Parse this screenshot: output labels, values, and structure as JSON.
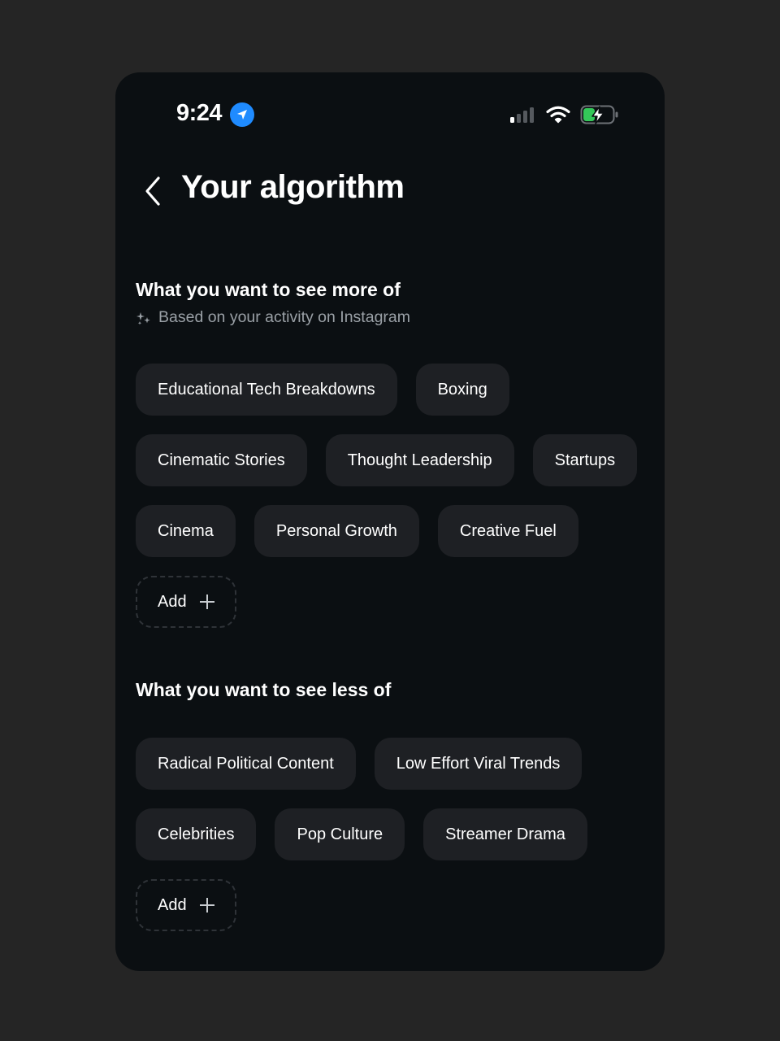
{
  "status_bar": {
    "time": "9:24",
    "icons": [
      "location-arrow-icon",
      "signal-icon",
      "wifi-icon",
      "battery-charging-icon"
    ],
    "location_color": "#1f8bff",
    "battery_color": "#34c759"
  },
  "header": {
    "back_icon": "chevron-left-icon",
    "title": "Your algorithm"
  },
  "more_of": {
    "title": "What you want to see more of",
    "subtitle": "Based on your activity on Instagram",
    "subtitle_icon": "sparkles-icon",
    "topics": [
      "Educational Tech Breakdowns",
      "Boxing",
      "Cinematic Stories",
      "Thought Leadership",
      "Startups",
      "Cinema",
      "Personal Growth",
      "Creative Fuel"
    ],
    "add_label": "Add"
  },
  "less_of": {
    "title": "What you want to see less of",
    "topics": [
      "Radical Political Content",
      "Low Effort Viral Trends",
      "Celebrities",
      "Pop Culture",
      "Streamer Drama"
    ],
    "add_label": "Add"
  },
  "colors": {
    "background": "#252525",
    "screen": "#0b0f12",
    "chip": "#1e2024",
    "text": "#ffffff",
    "muted_text": "#9aa0a6"
  }
}
